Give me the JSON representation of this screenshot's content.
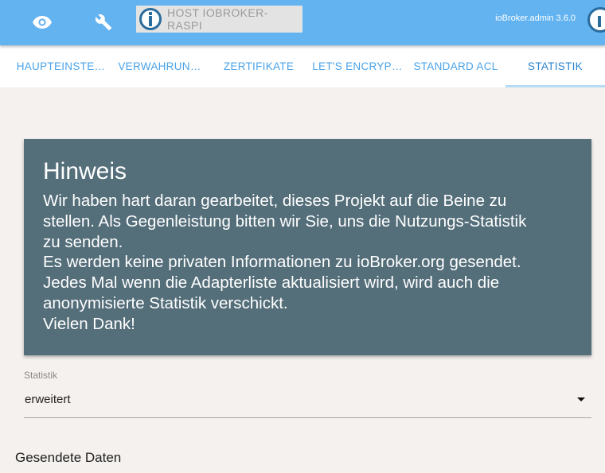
{
  "header": {
    "eye_icon": "eye-icon",
    "settings_icon": "wrench-icon",
    "host": {
      "logo_icon": "iobroker-logo-icon",
      "label": "HOST IOBROKER-RASPI"
    },
    "version": "ioBroker.admin 3.6.0",
    "brand_color": "#63b3f1"
  },
  "tabs": [
    {
      "label": "HAUPTEINSTE…",
      "active": false
    },
    {
      "label": "VERWAHRUN…",
      "active": false
    },
    {
      "label": "ZERTIFIKATE",
      "active": false
    },
    {
      "label": "LET'S ENCRYP…",
      "active": false
    },
    {
      "label": "STANDARD ACL",
      "active": false
    },
    {
      "label": "STATISTIK",
      "active": true
    }
  ],
  "notice": {
    "title": "Hinweis",
    "lines": [
      "Wir haben hart daran gearbeitet, dieses Projekt auf die Beine zu",
      "stellen. Als Gegenleistung bitten wir Sie, uns die Nutzungs-Statistik",
      "zu senden.",
      "Es werden keine privaten Informationen zu ioBroker.org gesendet.",
      "Jedes Mal wenn die Adapterliste aktualisiert wird, wird auch die",
      "anonymisierte Statistik verschickt.",
      "Vielen Dank!"
    ],
    "background_color": "#546e7a"
  },
  "statistics_field": {
    "label": "Statistik",
    "value": "erweitert",
    "dropdown_icon": "caret-down-icon"
  },
  "sent_data": {
    "title": "Gesendete Daten"
  }
}
